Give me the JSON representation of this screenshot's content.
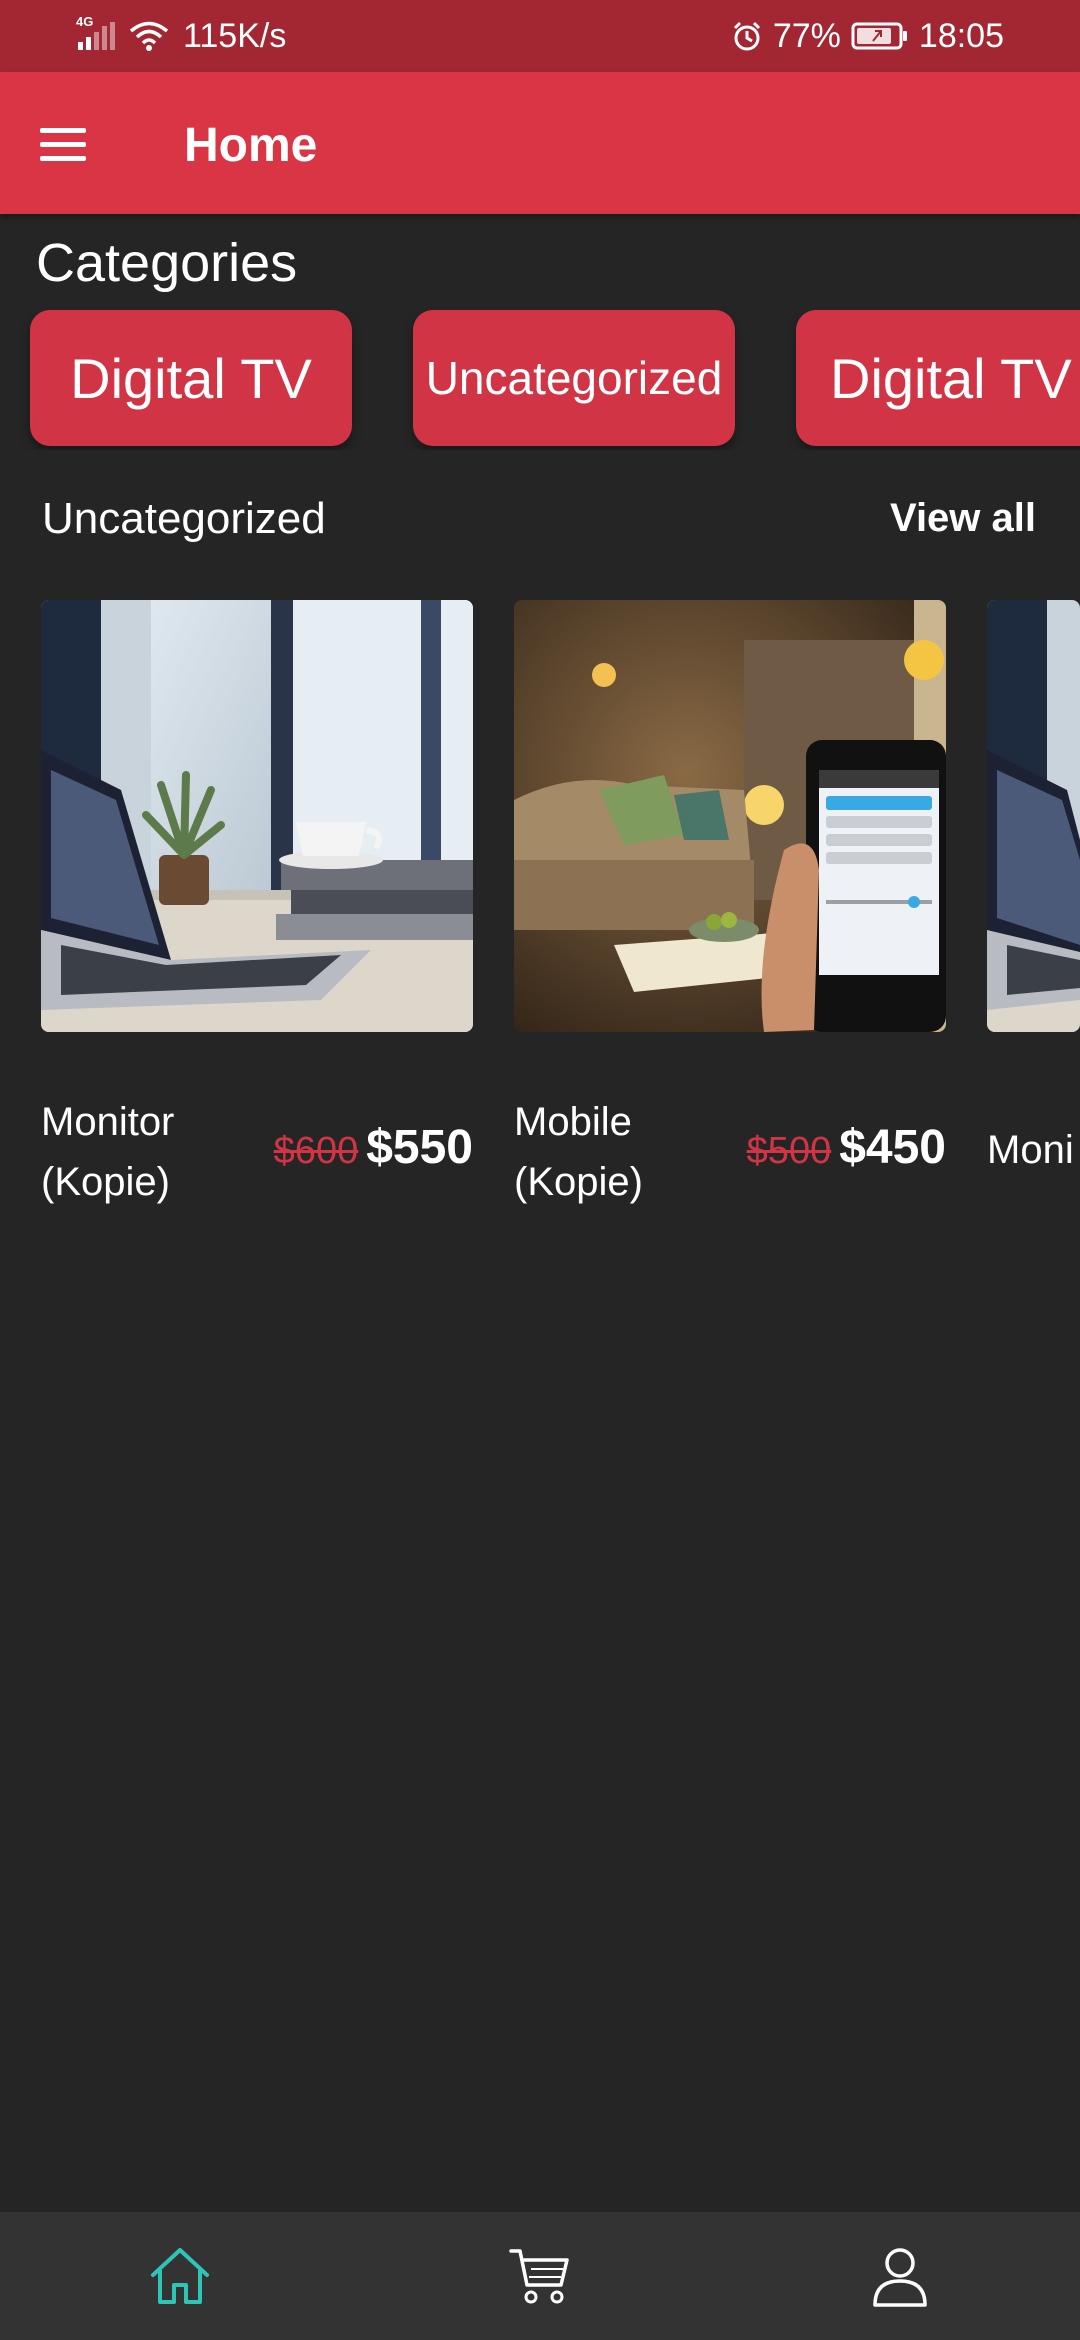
{
  "status_bar": {
    "network": "4G",
    "speed": "115K/s",
    "battery": "77%",
    "time": "18:05",
    "icons": [
      "signal-icon",
      "wifi-icon",
      "alarm-icon",
      "battery-icon"
    ]
  },
  "app_bar": {
    "title": "Home",
    "menu_icon": "menu-icon"
  },
  "categories": {
    "title": "Categories",
    "items": [
      {
        "label": "Digital TV"
      },
      {
        "label": "Uncategorized"
      },
      {
        "label": "Digital TV"
      }
    ]
  },
  "products_section": {
    "title": "Uncategorized",
    "view_all": "View all",
    "products": [
      {
        "name": "Monitor (Kopie)",
        "old_price": "$600",
        "price": "$550",
        "image": "laptop-desk-photo"
      },
      {
        "name": "Mobile (Kopie)",
        "old_price": "$500",
        "price": "$450",
        "image": "smartphone-living-room-photo"
      },
      {
        "name": "Moni",
        "image": "laptop-desk-photo"
      }
    ]
  },
  "bottom_nav": {
    "items": [
      {
        "name": "home",
        "icon": "home-icon",
        "active": true
      },
      {
        "name": "cart",
        "icon": "cart-icon",
        "active": false
      },
      {
        "name": "profile",
        "icon": "user-icon",
        "active": false
      }
    ]
  },
  "colors": {
    "status_bar": "#a32633",
    "app_bar": "#d93545",
    "accent": "#d13545",
    "background": "#252525",
    "nav_background": "#333333",
    "nav_active": "#2ec4b6"
  }
}
